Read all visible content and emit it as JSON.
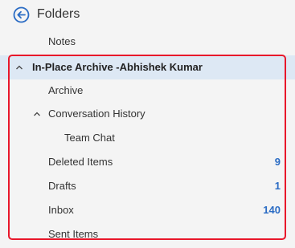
{
  "header": {
    "title": "Folders",
    "back_icon": "back-arrow-circle-icon"
  },
  "folders": {
    "notes": {
      "label": "Notes"
    },
    "archive_group": {
      "label": "In-Place Archive -Abhishek Kumar",
      "expanded": true
    },
    "archive": {
      "label": "Archive"
    },
    "conversation_history": {
      "label": "Conversation History",
      "expanded": true
    },
    "team_chat": {
      "label": "Team Chat"
    },
    "deleted_items": {
      "label": "Deleted Items",
      "count": "9"
    },
    "drafts": {
      "label": "Drafts",
      "count": "1"
    },
    "inbox": {
      "label": "Inbox",
      "count": "140"
    },
    "sent_items": {
      "label": "Sent Items"
    }
  },
  "colors": {
    "accent": "#2b6cc4",
    "selected_bg": "#dde8f4",
    "highlight_border": "#e8172a"
  }
}
